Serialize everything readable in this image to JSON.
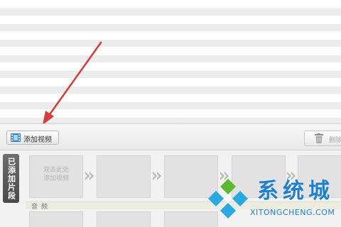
{
  "toolbar": {
    "add_video_label": "添加视频",
    "add_video_icon": "film-strip-icon",
    "delete_label": "删除",
    "delete_icon": "trash-icon"
  },
  "clips": {
    "side_tab_label": "已添加片段",
    "first_slot_hint_line1": "双击此处",
    "first_slot_hint_line2": "添加视频",
    "separator_icon": "double-chevron-right-icon"
  },
  "audio": {
    "label": "音频"
  },
  "watermark": {
    "cn": "系统城",
    "en": "XITONGCHENG.COM",
    "logo_icon": "xitongcheng-diamond-logo",
    "colors": {
      "blue": "#1f7fcf",
      "green": "#5cb82e",
      "teal": "#2aa8e0"
    }
  },
  "annotation": {
    "arrow_color": "#d93a3a",
    "arrow_icon": "red-arrow-pointer"
  }
}
